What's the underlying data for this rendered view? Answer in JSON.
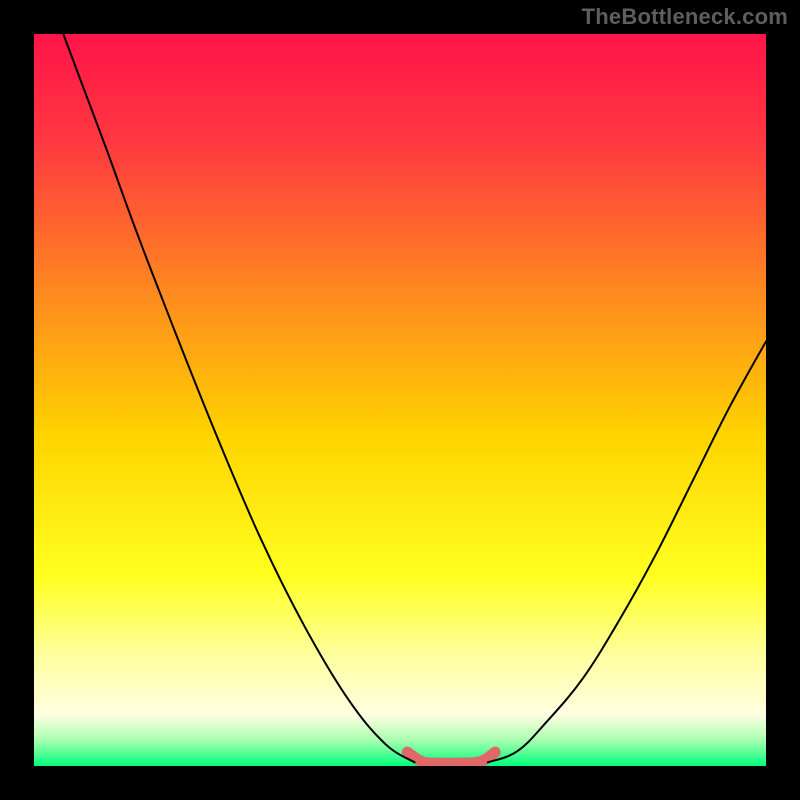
{
  "attribution": "TheBottleneck.com",
  "chart_data": {
    "type": "line",
    "title": "",
    "xlabel": "",
    "ylabel": "",
    "xlim": [
      0,
      100
    ],
    "ylim": [
      0,
      100
    ],
    "gradient_stops": [
      {
        "pos": 0.0,
        "color": "#ff1449"
      },
      {
        "pos": 0.15,
        "color": "#ff3940"
      },
      {
        "pos": 0.35,
        "color": "#ff8820"
      },
      {
        "pos": 0.55,
        "color": "#ffd400"
      },
      {
        "pos": 0.74,
        "color": "#ffff20"
      },
      {
        "pos": 0.85,
        "color": "#ffffa0"
      },
      {
        "pos": 0.93,
        "color": "#ffffe2"
      },
      {
        "pos": 0.965,
        "color": "#a8ffb0"
      },
      {
        "pos": 1.0,
        "color": "#00ff7a"
      }
    ],
    "series": [
      {
        "name": "left-curve",
        "color": "#000000",
        "width": 2,
        "x": [
          4,
          7,
          10,
          14,
          19,
          25,
          31,
          37,
          43,
          48,
          52
        ],
        "y": [
          100,
          92,
          84,
          73,
          60,
          45,
          31,
          19,
          9,
          3,
          0.5
        ]
      },
      {
        "name": "right-curve",
        "color": "#000000",
        "width": 2,
        "x": [
          62,
          66,
          70,
          75,
          80,
          85,
          90,
          95,
          100
        ],
        "y": [
          0.5,
          2,
          6,
          12,
          20,
          29,
          39,
          49,
          58
        ]
      },
      {
        "name": "bottom-highlight",
        "color": "#e06868",
        "width": 11,
        "cap": "round",
        "x": [
          51,
          53,
          55,
          58,
          61,
          63
        ],
        "y": [
          1.9,
          0.6,
          0.4,
          0.4,
          0.6,
          1.9
        ]
      }
    ]
  }
}
